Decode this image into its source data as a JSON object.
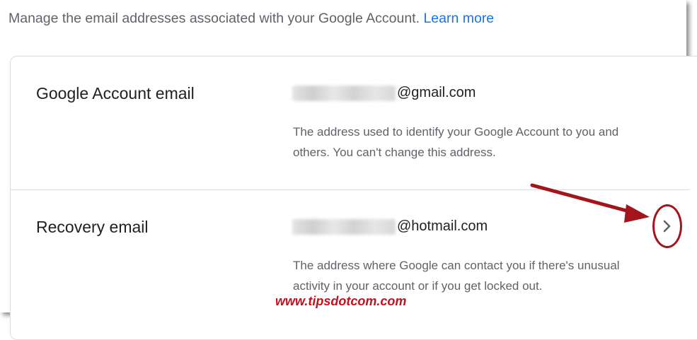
{
  "intro": {
    "text": "Manage the email addresses associated with your Google Account.",
    "link": "Learn more"
  },
  "rows": [
    {
      "title": "Google Account email",
      "email_suffix": "@gmail.com",
      "description_line1": "The address used to identify your Google Account to you and",
      "description_line2": "others. You can't change this address."
    },
    {
      "title": "Recovery email",
      "email_suffix": "@hotmail.com",
      "description_line1": "The address where Google can contact you if there's unusual",
      "description_line2": "activity in your account or if you get locked out."
    }
  ],
  "watermark": "www.tipsdotcom.com",
  "icons": {
    "chevron": "chevron-right-icon",
    "annotation_arrow": "red-arrow-icon"
  },
  "colors": {
    "link": "#1a73e8",
    "annotation": "#a3141b",
    "watermark": "#c1121f"
  }
}
